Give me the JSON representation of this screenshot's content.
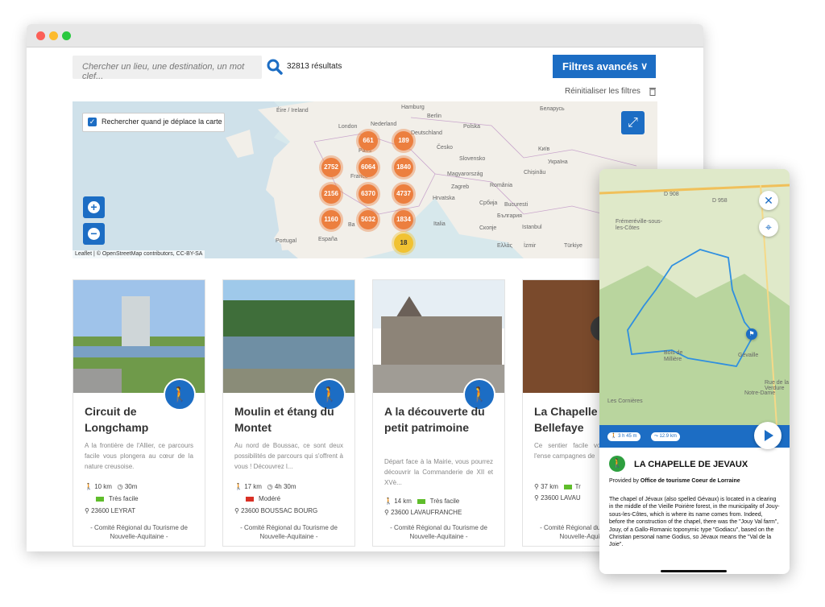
{
  "search": {
    "placeholder": "Chercher un lieu, une destination, un mot clef...",
    "results": "32813 résultats"
  },
  "filters": {
    "label": "Filtres avancés",
    "chevron": "∨"
  },
  "reset": {
    "label": "Réinitialiser les filtres"
  },
  "map": {
    "checkbox_label": "Rechercher quand je déplace la carte",
    "attribution": "Leaflet | © OpenStreetMap contributors, CC-BY-SA",
    "zoom_in": "+",
    "zoom_out": "−",
    "clusters": [
      "661",
      "189",
      "2752",
      "6064",
      "1840",
      "2156",
      "6370",
      "4737",
      "1160",
      "5032",
      "1834",
      "18"
    ],
    "labels": [
      "Éire / Ireland",
      "London",
      "Nederland",
      "Hamburg",
      "Berlin",
      "Беларусь",
      "Polska",
      "Deutschland",
      "Paris",
      "France",
      "Česko",
      "Slovensko",
      "Magyarország",
      "Kиїв",
      "Україна",
      "Chișinău",
      "Zagreb",
      "România",
      "Hrvatska",
      "Србија",
      "Bucuresti",
      "България",
      "Italia",
      "Portugal",
      "España",
      "Ελλάς",
      "İzmir",
      "Türkiye",
      "Istanbul",
      "Скопје",
      "Ba"
    ]
  },
  "cards": [
    {
      "title": "Circuit de Longchamp",
      "desc": "A la frontière de l'Allier, ce parcours facile vous plongera au cœur de la nature creusoise.",
      "distance": "10 km",
      "duration": "30m",
      "difficulty": "Très facile",
      "diff_color": "#5fbd2b",
      "location": "23600 LEYRAT",
      "org": "- Comité Régional du Tourisme de Nouvelle-Aquitaine -",
      "activity_icon": "hiking-icon"
    },
    {
      "title": "Moulin et étang du Montet",
      "desc": "Au nord de Boussac, ce sont deux possibilités de parcours qui s'offrent à vous ! Découvrez l...",
      "distance": "17 km",
      "duration": "4h 30m",
      "difficulty": "Modéré",
      "diff_color": "#d93025",
      "location": "23600 BOUSSAC BOURG",
      "org": "- Comité Régional du Tourisme de Nouvelle-Aquitaine -",
      "activity_icon": "hiking-icon"
    },
    {
      "title": "A la découverte du petit patrimoine",
      "desc": "Départ face à la Mairie, vous pourrez découvrir la Commanderie de XII et XVè...",
      "distance": "14 km",
      "duration": "",
      "difficulty": "Très facile",
      "diff_color": "#5fbd2b",
      "location": "23600 LAVAUFRANCHE",
      "org": "- Comité Régional du Tourisme de Nouvelle-Aquitaine -",
      "activity_icon": "hiking-icon"
    },
    {
      "title": "La Chapelle Bellefaye",
      "desc": "Ce sentier facile vous d'observer l'ense campagnes de",
      "distance": "37 km",
      "duration": "",
      "difficulty": "Tr",
      "diff_color": "#5fbd2b",
      "location": "23600 LAVAU",
      "org": "- Comité Régional du Tourisme de Nouvelle-Aquitaine -",
      "activity_icon": "cycling-icon"
    }
  ],
  "phone": {
    "map_labels": [
      "D 908",
      "D 958",
      "Frémeréville-sous-les-Côtes",
      "Bois de Millière",
      "Les Cornières",
      "Gévaille",
      "Rue de la Verdure",
      "Notre-Dame"
    ],
    "pill_duration": "3 h 45 m",
    "pill_distance": "12.9 km",
    "title": "LA CHAPELLE DE JEVAUX",
    "provided_by_prefix": "Provided by ",
    "provided_by_org": "Office de tourisme Coeur de Lorraine",
    "text": "The chapel of Jévaux (also spelled Gévaux) is located in a clearing in the middle of the Vieille Poirière forest, in the municipality of Jouy-sous-les-Côtes, which is where its name comes from. Indeed, before the construction of the chapel, there was the \"Jouy Val farm\", Jouy, of a Gallo-Romanic toponymic type \"Godiacu\", based on the Christian personal name Godius, so Jévaux means the \"Val de la Joie\"."
  },
  "colors": {
    "accent": "#1c6dc4",
    "cluster": "#ec7f3f",
    "cluster_small": "#f1c232",
    "easy": "#5fbd2b",
    "moderate": "#d93025"
  }
}
